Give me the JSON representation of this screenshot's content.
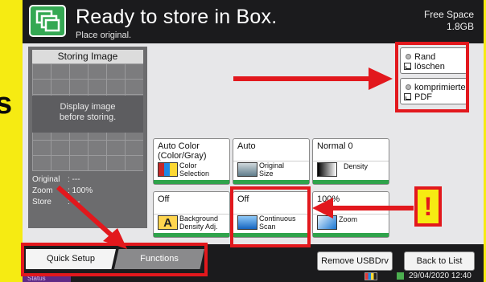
{
  "header": {
    "title": "Ready to store in Box.",
    "subtitle": "Place original.",
    "free_space_label": "Free Space",
    "free_space_value": "1.8GB"
  },
  "page_fragment": "s",
  "preview": {
    "title": "Storing Image",
    "message_line1": "Display image",
    "message_line2": "before storing.",
    "info": [
      {
        "label": "Original",
        "value": ": ---"
      },
      {
        "label": "Zoom",
        "value": ": 100%"
      },
      {
        "label": "Store",
        "value": ": ---"
      }
    ]
  },
  "right_buttons": [
    {
      "line1": "Rand löschen",
      "line2": ""
    },
    {
      "line1": "komprimierte",
      "line2": "PDF"
    }
  ],
  "tiles": [
    {
      "value_line1": "Auto Color",
      "value_line2": "(Color/Gray)",
      "label_line1": "Color",
      "label_line2": "Selection",
      "icon": "color-selection-icon"
    },
    {
      "value_line1": "Auto",
      "value_line2": "",
      "label_line1": "Original",
      "label_line2": "Size",
      "icon": "original-size-icon"
    },
    {
      "value_line1": "Normal 0",
      "value_line2": "",
      "label_line1": "Density",
      "label_line2": "",
      "icon": "density-icon"
    },
    {
      "value_line1": "Off",
      "value_line2": "",
      "label_line1": "Background",
      "label_line2": "Density Adj.",
      "icon": "background-density-icon"
    },
    {
      "value_line1": "Off",
      "value_line2": "",
      "label_line1": "Continuous",
      "label_line2": "Scan",
      "icon": "continuous-scan-icon"
    },
    {
      "value_line1": "100%",
      "value_line2": "",
      "label_line1": "Zoom",
      "label_line2": "",
      "icon": "zoom-icon"
    }
  ],
  "tabs": {
    "quick_setup": "Quick Setup",
    "functions": "Functions"
  },
  "status_label": "Status",
  "buttons": {
    "remove_usb": "Remove USBDrv",
    "back_to_list": "Back to List"
  },
  "datetime": "29/04/2020  12:40",
  "annotation": {
    "exclamation": "!",
    "highlight_color": "#e2181d",
    "background_color": "#f6eb12"
  }
}
